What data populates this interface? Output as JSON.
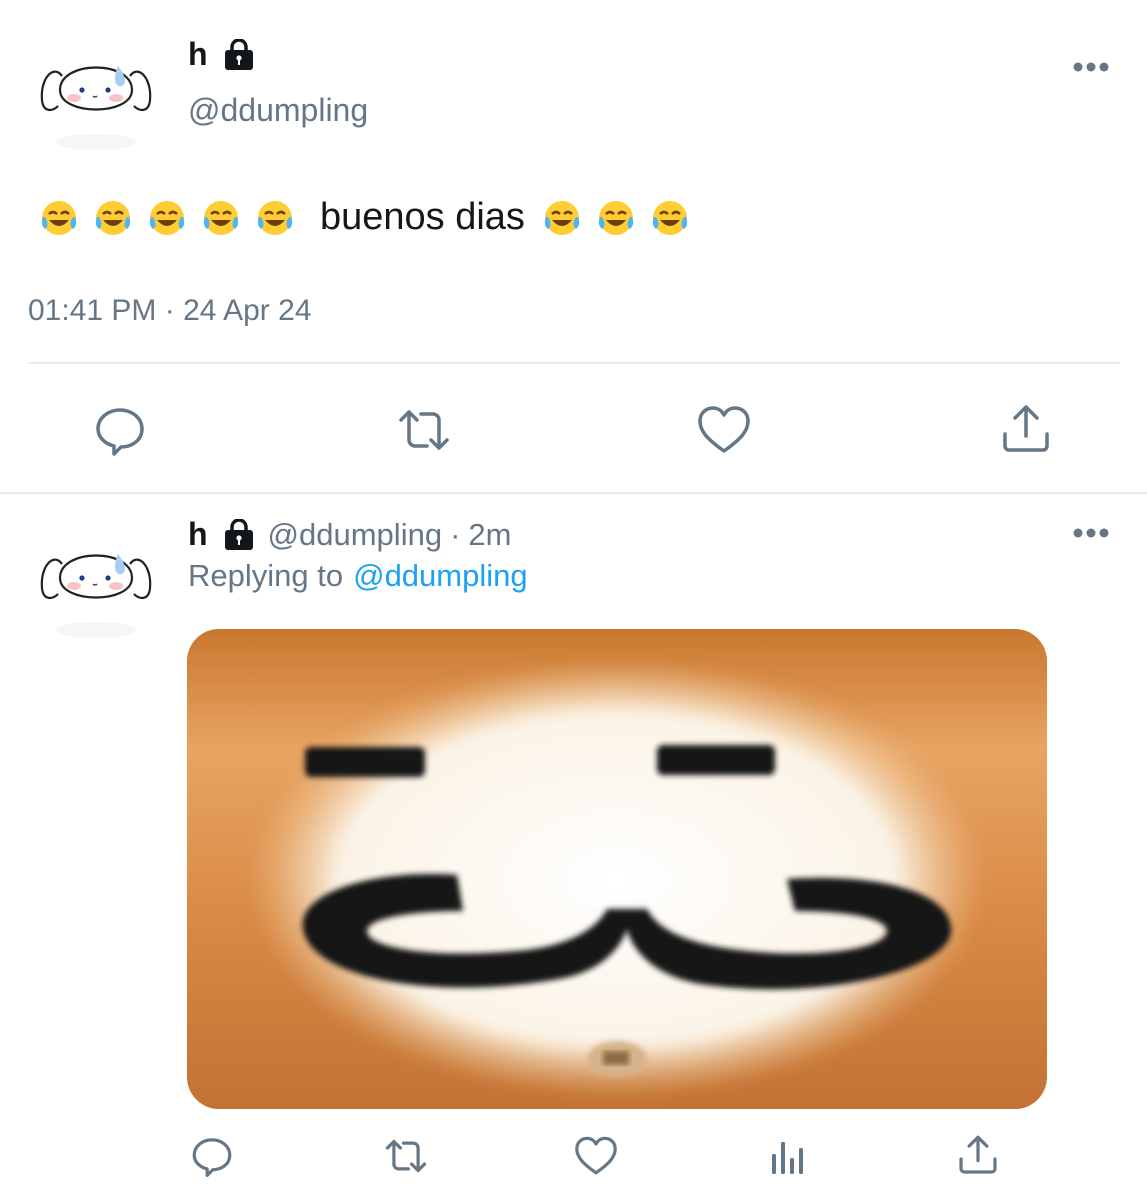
{
  "main_tweet": {
    "display_name": "h",
    "handle": "@ddumpling",
    "text": "buenos dias",
    "timestamp": "01:41 PM · 24 Apr 24",
    "locked": true
  },
  "reply": {
    "display_name": "h",
    "handle": "@ddumpling",
    "separator": "·",
    "time_ago": "2m",
    "replying_prefix": "Replying to",
    "replying_handle": "@ddumpling",
    "locked": true
  },
  "icons": {
    "reply": "comment-icon",
    "retweet": "retweet-icon",
    "like": "heart-icon",
    "share": "share-icon",
    "analytics": "analytics-icon",
    "more": "more-icon",
    "lock": "lock-icon"
  },
  "colors": {
    "text": "#14171a",
    "secondary": "#657786",
    "link": "#1da1f2",
    "divider": "#e6ecf0"
  }
}
